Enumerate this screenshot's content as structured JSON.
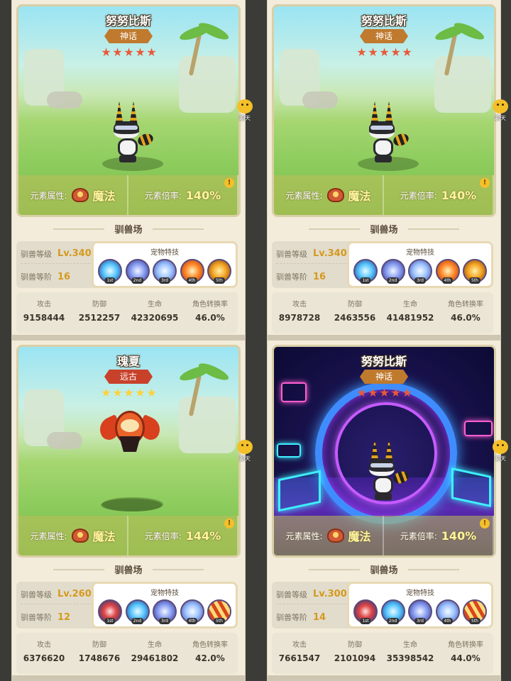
{
  "colors": {
    "myth_badge": "#c07a2e",
    "ancient_badge": "#c8412a",
    "star_red": "#e85a3a",
    "star_gold": "#ffd23a",
    "level_gold": "#d49a1e"
  },
  "chat_label": "聊天",
  "cards": [
    {
      "pet_name": "努努比斯",
      "rarity": "神话",
      "star_count": 5,
      "star_color": "red",
      "scene": "meadow",
      "element_label": "元素属性:",
      "element_value": "魔法",
      "multiplier_label": "元素倍率:",
      "multiplier_value": "140%",
      "section_title": "驯兽场",
      "level_label": "驯兽等级",
      "level_value": "Lv.340",
      "stage_label": "驯兽等阶",
      "stage_value": "16",
      "skills_title": "宠物特技",
      "skills": [
        {
          "icon": "ice-flower-icon",
          "tag": "1st"
        },
        {
          "icon": "crystal-shard-icon",
          "tag": "2nd"
        },
        {
          "icon": "ice-crystal-icon",
          "tag": "3rd"
        },
        {
          "icon": "fire-slash-icon",
          "tag": "4th"
        },
        {
          "icon": "shadow-pet-icon",
          "tag": "5th"
        }
      ],
      "stats": [
        {
          "label": "攻击",
          "value": "9158444"
        },
        {
          "label": "防御",
          "value": "2512257"
        },
        {
          "label": "生命",
          "value": "42320695"
        },
        {
          "label": "角色转换率",
          "value": "46.0%"
        }
      ]
    },
    {
      "pet_name": "努努比斯",
      "rarity": "神话",
      "star_count": 5,
      "star_color": "red",
      "scene": "meadow",
      "element_label": "元素属性:",
      "element_value": "魔法",
      "multiplier_label": "元素倍率:",
      "multiplier_value": "140%",
      "section_title": "驯兽场",
      "level_label": "驯兽等级",
      "level_value": "Lv.340",
      "stage_label": "驯兽等阶",
      "stage_value": "16",
      "skills_title": "宠物特技",
      "skills": [
        {
          "icon": "ice-flower-icon",
          "tag": "1st"
        },
        {
          "icon": "crystal-shard-icon",
          "tag": "2nd"
        },
        {
          "icon": "ice-crystal-icon",
          "tag": "3rd"
        },
        {
          "icon": "fire-slash-icon",
          "tag": "4th"
        },
        {
          "icon": "shadow-pet-icon",
          "tag": "5th"
        }
      ],
      "stats": [
        {
          "label": "攻击",
          "value": "8978728"
        },
        {
          "label": "防御",
          "value": "2463556"
        },
        {
          "label": "生命",
          "value": "41481952"
        },
        {
          "label": "角色转换率",
          "value": "46.0%"
        }
      ]
    },
    {
      "pet_name": "瑰夏",
      "rarity": "远古",
      "star_count": 5,
      "star_color": "gold",
      "scene": "meadow",
      "element_label": "元素属性:",
      "element_value": "魔法",
      "multiplier_label": "元素倍率:",
      "multiplier_value": "144%",
      "section_title": "驯兽场",
      "level_label": "驯兽等级",
      "level_value": "Lv.260",
      "stage_label": "驯兽等阶",
      "stage_value": "12",
      "skills_title": "宠物特技",
      "skills": [
        {
          "icon": "star-shield-icon",
          "tag": "1st"
        },
        {
          "icon": "ice-flower-icon",
          "tag": "2nd"
        },
        {
          "icon": "crystal-shard-icon",
          "tag": "3rd"
        },
        {
          "icon": "ice-crystal-icon",
          "tag": "4th"
        },
        {
          "icon": "flame-orb-icon",
          "tag": "5th"
        }
      ],
      "stats": [
        {
          "label": "攻击",
          "value": "6376620"
        },
        {
          "label": "防御",
          "value": "1748676"
        },
        {
          "label": "生命",
          "value": "29461802"
        },
        {
          "label": "角色转换率",
          "value": "42.0%"
        }
      ]
    },
    {
      "pet_name": "努努比斯",
      "rarity": "神话",
      "star_count": 5,
      "star_color": "red",
      "scene": "neon",
      "element_label": "元素属性:",
      "element_value": "魔法",
      "multiplier_label": "元素倍率:",
      "multiplier_value": "140%",
      "section_title": "驯兽场",
      "level_label": "驯兽等级",
      "level_value": "Lv.300",
      "stage_label": "驯兽等阶",
      "stage_value": "14",
      "skills_title": "宠物特技",
      "skills": [
        {
          "icon": "star-shield-icon",
          "tag": "1st"
        },
        {
          "icon": "ice-flower-icon",
          "tag": "2nd"
        },
        {
          "icon": "crystal-shard-icon",
          "tag": "3rd"
        },
        {
          "icon": "ice-crystal-icon",
          "tag": "4th"
        },
        {
          "icon": "flame-orb-icon",
          "tag": "5th"
        }
      ],
      "stats": [
        {
          "label": "攻击",
          "value": "7661547"
        },
        {
          "label": "防御",
          "value": "2101094"
        },
        {
          "label": "生命",
          "value": "35398542"
        },
        {
          "label": "角色转换率",
          "value": "44.0%"
        }
      ]
    }
  ]
}
